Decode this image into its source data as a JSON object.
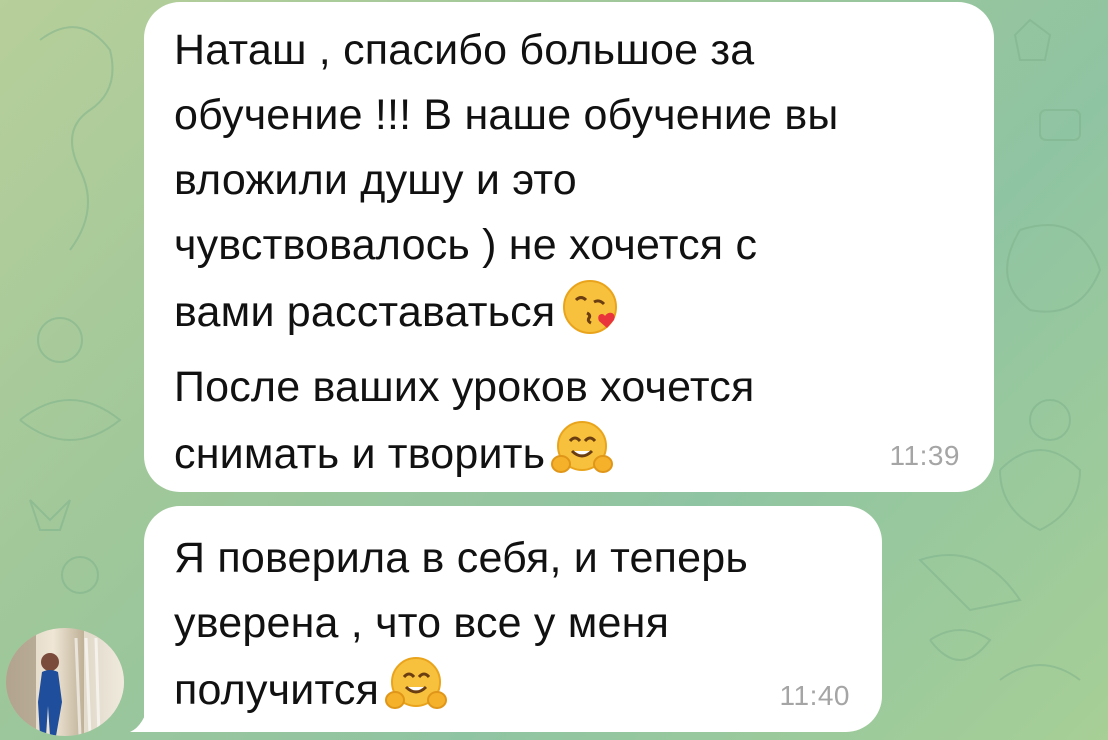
{
  "chat": {
    "messages": [
      {
        "lines": [
          "Наташ , спасибо большое за",
          "обучение !!! В наше обучение вы",
          "вложили душу и это",
          "чувствовалось ) не хочется с",
          "вами расставаться",
          "После ваших уроков хочется",
          "снимать и творить"
        ],
        "time": "11:39",
        "emojis": [
          "kissing-heart-emoji",
          "hugging-face-emoji"
        ]
      },
      {
        "lines": [
          "Я поверила в себя, и теперь",
          "уверена , что все у меня",
          "получится"
        ],
        "time": "11:40",
        "emojis": [
          "hugging-face-emoji"
        ]
      }
    ]
  },
  "colors": {
    "bubble": "#ffffff",
    "text": "#111111",
    "timestamp": "#a5a5a5",
    "wallpaper": "#9fc79a"
  },
  "icons": {
    "avatar": "sender-avatar-photo"
  }
}
